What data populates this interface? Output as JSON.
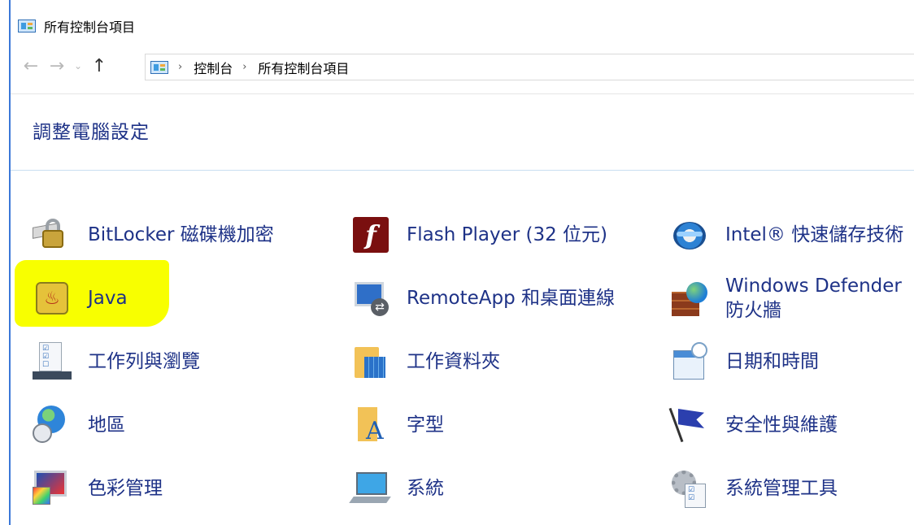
{
  "window": {
    "title": "所有控制台項目"
  },
  "nav": {
    "back_icon": "back-arrow-icon",
    "forward_icon": "forward-arrow-icon",
    "recent_icon": "chevron-down-icon",
    "up_icon": "up-arrow-icon"
  },
  "breadcrumb": [
    "控制台",
    "所有控制台項目"
  ],
  "page": {
    "title": "調整電腦設定"
  },
  "items": [
    {
      "label": "BitLocker 磁碟機加密",
      "icon": "bitlocker-icon"
    },
    {
      "label": "Flash Player (32 位元)",
      "icon": "flash-player-icon"
    },
    {
      "label": "Intel® 快速儲存技術",
      "icon": "intel-rst-icon"
    },
    {
      "label": "Java",
      "icon": "java-icon"
    },
    {
      "label": "RemoteApp 和桌面連線",
      "icon": "remoteapp-icon"
    },
    {
      "label": "Windows Defender 防火牆",
      "icon": "firewall-icon"
    },
    {
      "label": "工作列與瀏覽",
      "icon": "taskbar-icon"
    },
    {
      "label": "工作資料夾",
      "icon": "work-folders-icon"
    },
    {
      "label": "日期和時間",
      "icon": "date-time-icon"
    },
    {
      "label": "地區",
      "icon": "region-icon"
    },
    {
      "label": "字型",
      "icon": "fonts-icon"
    },
    {
      "label": "安全性與維護",
      "icon": "security-maintenance-icon"
    },
    {
      "label": "色彩管理",
      "icon": "color-management-icon"
    },
    {
      "label": "系統",
      "icon": "system-icon"
    },
    {
      "label": "系統管理工具",
      "icon": "admin-tools-icon"
    }
  ],
  "highlight": {
    "target": "Java",
    "color": "#f8ff00"
  },
  "colors": {
    "link": "#1e3287",
    "accent_border": "#3b78d8"
  }
}
